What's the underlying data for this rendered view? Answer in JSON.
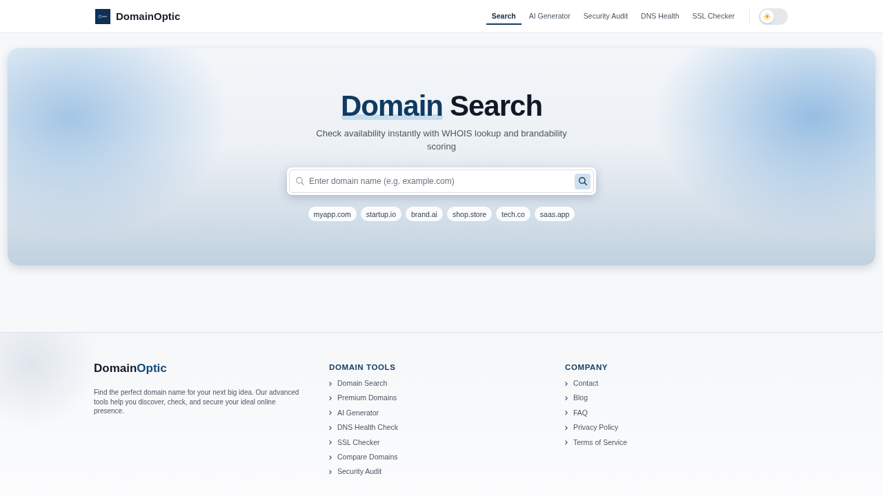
{
  "header": {
    "brand": "DomainOptic",
    "nav": [
      {
        "label": "Search",
        "selected": true
      },
      {
        "label": "AI Generator",
        "selected": false
      },
      {
        "label": "Security Audit",
        "selected": false
      },
      {
        "label": "DNS Health",
        "selected": false
      },
      {
        "label": "SSL Checker",
        "selected": false
      }
    ],
    "theme_toggle": {
      "dark_mode": false
    }
  },
  "hero": {
    "title": [
      {
        "text": "Domain",
        "highlighted": true
      },
      {
        "text": "Search",
        "highlighted": false
      }
    ],
    "subtitle": "Check availability instantly with WHOIS lookup and brandability scoring",
    "search": {
      "placeholder": "Enter domain name (e.g. example.com)"
    },
    "suggestions": [
      "myapp.com",
      "startup.io",
      "brand.ai",
      "shop.store",
      "tech.co",
      "saas.app"
    ]
  },
  "footer": {
    "brand": [
      {
        "text": "Domain",
        "accent": false
      },
      {
        "text": "Optic",
        "accent": true
      }
    ],
    "description": "Find the perfect domain name for your next big idea. Our advanced tools help you discover, check, and secure your ideal online presence.",
    "columns": [
      {
        "heading": "DOMAIN TOOLS",
        "links": [
          "Domain Search",
          "Premium Domains",
          "AI Generator",
          "DNS Health Check",
          "SSL Checker",
          "Compare Domains",
          "Security Audit"
        ]
      },
      {
        "heading": "COMPANY",
        "links": [
          "Contact",
          "Blog",
          "FAQ",
          "Privacy Policy",
          "Terms of Service"
        ]
      }
    ]
  }
}
